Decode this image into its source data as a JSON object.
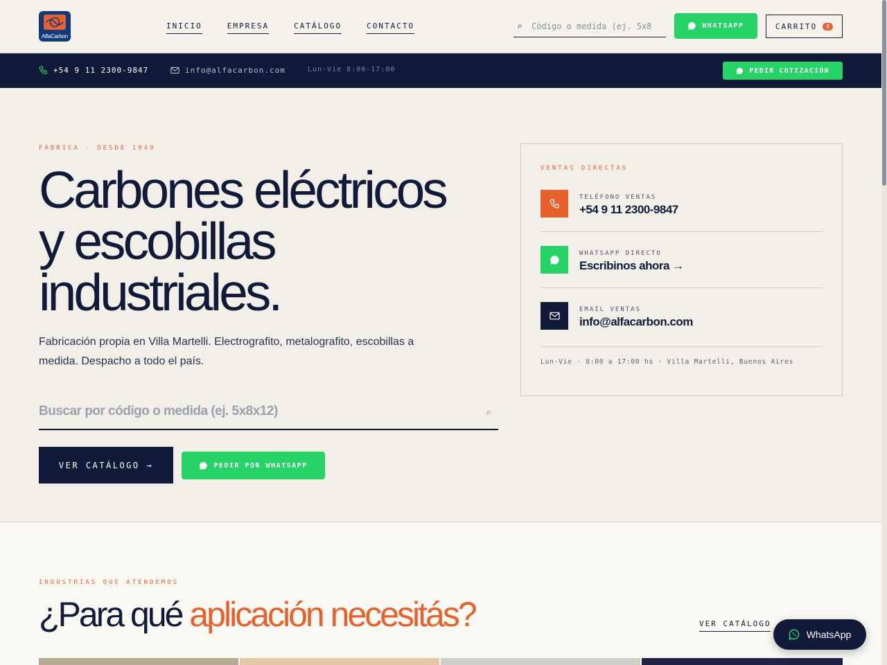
{
  "brand": {
    "logo_text": "AlfaCarbon",
    "colors": {
      "navy": "#121a3a",
      "orange": "#e8612d",
      "green": "#25d366",
      "cream": "#f4f1ea"
    }
  },
  "nav": {
    "items": [
      {
        "label": "INICIO"
      },
      {
        "label": "EMPRESA"
      },
      {
        "label": "CATÁLOGO"
      },
      {
        "label": "CONTACTO"
      }
    ]
  },
  "header": {
    "search_placeholder": "Código o medida (ej. 5x8",
    "whatsapp_label": "WHATSAPP",
    "cart_label": "CARRITO",
    "cart_count": "0"
  },
  "topbar": {
    "phone": "+54 9 11 2300-9847",
    "email": "info@alfacarbon.com",
    "hours": "Lun-Vie 8:00-17:00",
    "quote_label": "PEDIR COTIZACIÓN"
  },
  "hero": {
    "eyebrow": "FÁBRICA · DESDE 1949",
    "title_lines": [
      "Carbones eléctricos",
      "y escobillas",
      "industriales."
    ],
    "lead": "Fabricación propia en Villa Martelli. Electrografito, metalografito, escobillas a medida. Despacho a todo el país.",
    "search_placeholder": "Buscar por código o medida (ej. 5x8x12)",
    "catalog_button": "VER CATÁLOGO →",
    "whatsapp_button": "PEDIR POR WHATSAPP"
  },
  "sales_card": {
    "eyebrow": "VENTAS DIRECTAS",
    "rows": [
      {
        "label": "TELÉFONO VENTAS",
        "value": "+54 9 11 2300-9847",
        "icon": "phone-icon"
      },
      {
        "label": "WHATSAPP DIRECTO",
        "value": "Escribinos ahora →",
        "icon": "whatsapp-icon"
      },
      {
        "label": "EMAIL VENTAS",
        "value": "info@alfacarbon.com",
        "icon": "mail-icon"
      }
    ],
    "footer": "Lun-Vie · 8:00 a 17:00 hs · Villa Martelli, Buenos Aires"
  },
  "industries": {
    "eyebrow": "INDUSTRIAS QUE ATENDEMOS",
    "title_main": "¿Para qué ",
    "title_accent": "aplicación necesitás?",
    "catalog_link": "VER CATÁLOGO"
  },
  "floating_whatsapp": {
    "label": "WhatsApp"
  }
}
